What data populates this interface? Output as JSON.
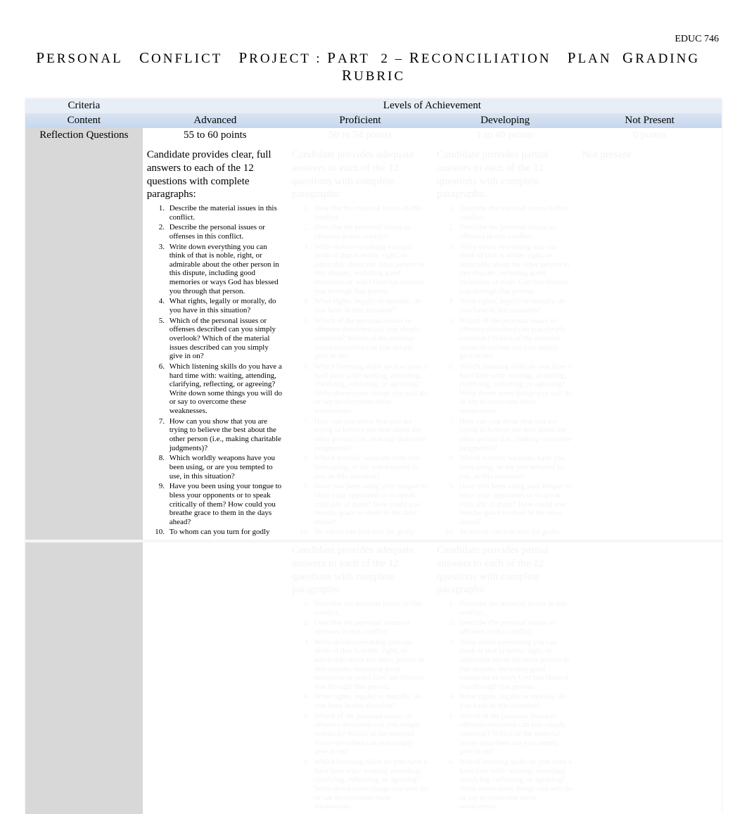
{
  "course_code": "EDUC 746",
  "title_parts": {
    "p1": "P",
    "t1": "ERSONAL",
    "p2": "C",
    "t2": "ONFLICT",
    "p3": "P",
    "t3": "ROJECT",
    "colon": ":",
    "p4": "P",
    "t4": "ART",
    "num": "2",
    "dash": "–",
    "p5": "R",
    "t5": "ECONCILIATION",
    "p6": "P",
    "t6": "LAN",
    "p7": "G",
    "t7": "RADING",
    "p8": "R",
    "t8": "UBRIC"
  },
  "header": {
    "criteria": "Criteria",
    "levels": "Levels of Achievement"
  },
  "header2": {
    "content": "Content",
    "advanced": "Advanced",
    "proficient": "Proficient",
    "developing": "Developing",
    "not_present": "Not Present"
  },
  "row": {
    "criteria": "Reflection Questions",
    "points": {
      "advanced": "55 to 60 points",
      "proficient": "50 to 54 points",
      "developing": "1 to 49 points",
      "not_present": "0 points"
    },
    "intros": {
      "advanced": "Candidate provides clear, full answers to each of the 12 questions with complete paragraphs:",
      "proficient": "Candidate provides adequate answers to each of the 12 questions with complete paragraphs:",
      "developing": "Candidate provides partial answers to each of the 12 questions with complete paragraphs:",
      "not_present": "Not present"
    },
    "questions": [
      "Describe the material issues in this conflict.",
      "Describe the personal issues or offenses in this conflict.",
      "Write down everything you can think of that is noble, right, or admirable about the other person in this dispute, including good memories or ways God has blessed you through that person.",
      "What rights, legally or morally, do you have in this situation?",
      "Which of the personal issues or offenses described can you simply overlook? Which of the material issues described can you simply give in on?",
      "Which listening skills do you have a hard time with: waiting, attending, clarifying, reflecting, or agreeing? Write down some things you will do or say to overcome these weaknesses.",
      "How can you show that you are trying to believe the best about the other person (i.e., making charitable judgments)?",
      "Which worldly weapons have you been using, or are you tempted to use, in this situation?",
      "Have you been using your tongue to bless your opponents or to speak critically of them? How could you breathe grace to them in the days ahead?",
      "To whom can you turn for godly"
    ]
  }
}
